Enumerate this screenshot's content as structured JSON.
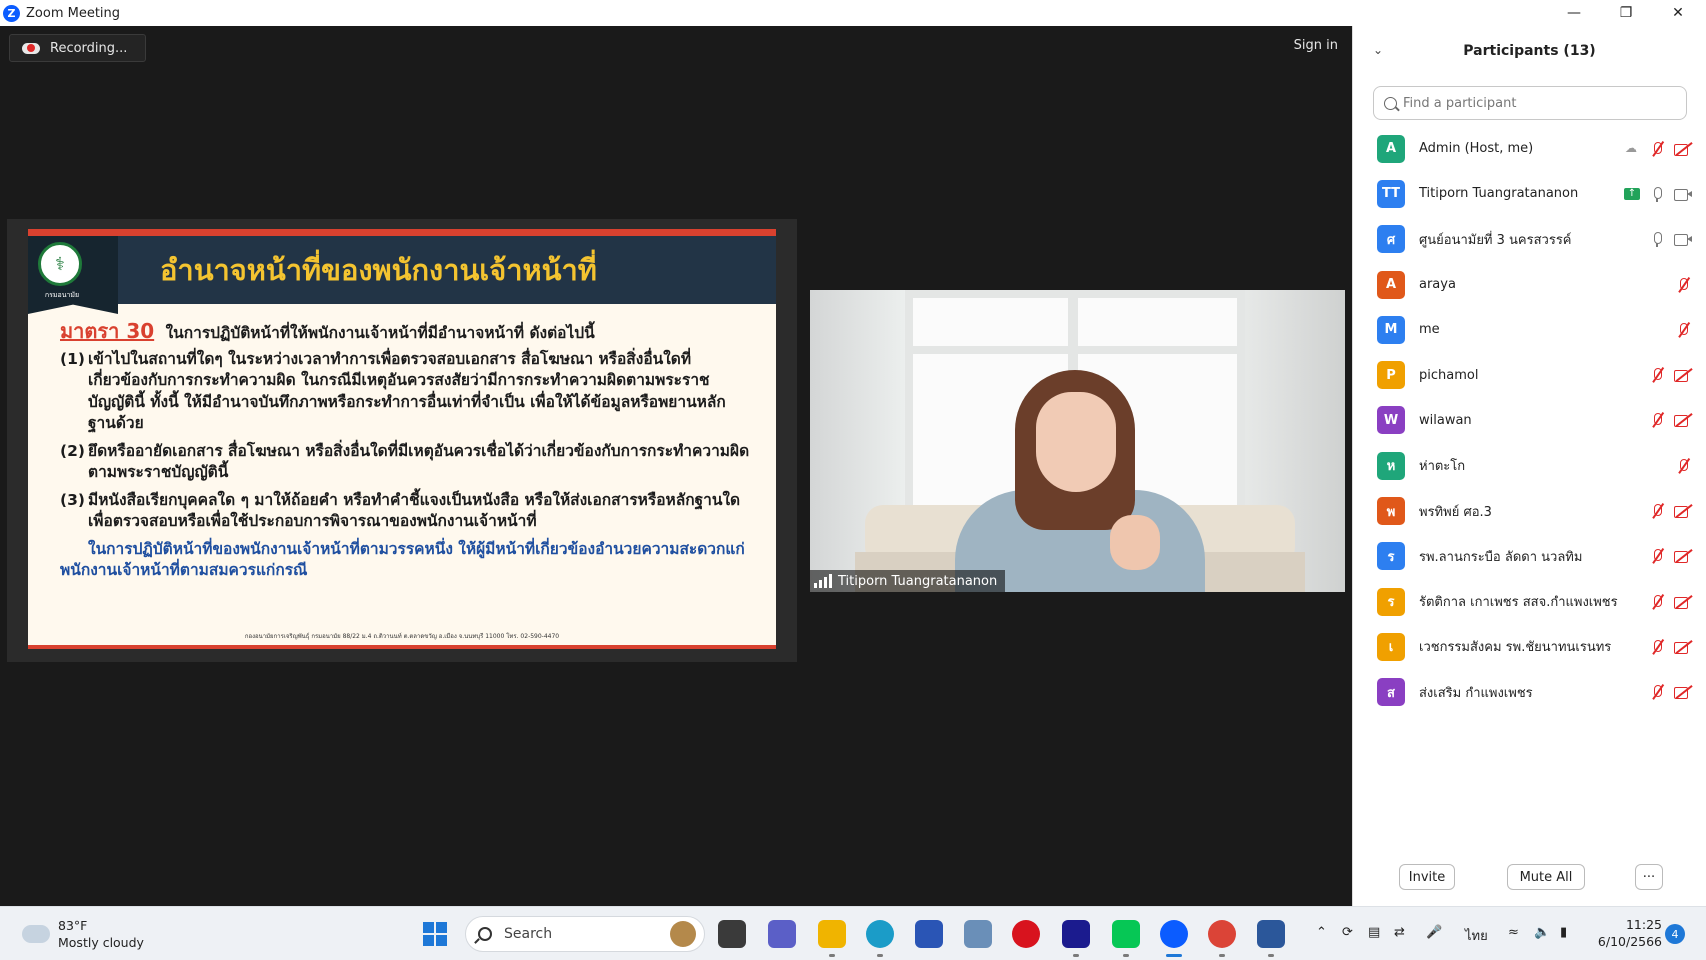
{
  "window": {
    "title": "Zoom Meeting",
    "minimize_icon": "minimize-icon",
    "restore_icon": "restore-icon",
    "close_icon": "close-icon"
  },
  "meeting": {
    "recording_label": "Recording...",
    "signin_label": "Sign in",
    "speaker_name": "Titiporn Tuangratananon"
  },
  "slide": {
    "logo_text": "กรมอนามัย",
    "title": "อำนาจหน้าที่ของพนักงานเจ้าหน้าที่",
    "section_no": "มาตรา 30",
    "section_text": "ในการปฏิบัติหน้าที่ให้พนักงานเจ้าหน้าที่มีอำนาจหน้าที่ ดังต่อไปนี้",
    "items": [
      {
        "num": "(1)",
        "text": "เข้าไปในสถานที่ใดๆ ในระหว่างเวลาทำการเพื่อตรวจสอบเอกสาร สื่อโฆษณา หรือสิ่งอื่นใดที่เกี่ยวข้องกับการกระทำความผิด ในกรณีมีเหตุอันควรสงสัยว่ามีการกระทำความผิดตามพระราชบัญญัตินี้ ทั้งนี้ ให้มีอำนาจบันทึกภาพหรือกระทำการอื่นเท่าที่จำเป็น เพื่อให้ได้ข้อมูลหรือพยานหลักฐานด้วย"
      },
      {
        "num": "(2)",
        "text": "ยึดหรืออายัดเอกสาร สื่อโฆษณา หรือสิ่งอื่นใดที่มีเหตุอันควรเชื่อได้ว่าเกี่ยวข้องกับการกระทำความผิดตามพระราชบัญญัตินี้"
      },
      {
        "num": "(3)",
        "text": "มีหนังสือเรียกบุคคลใด ๆ มาให้ถ้อยคำ หรือทำคำชี้แจงเป็นหนังสือ หรือให้ส่งเอกสารหรือหลักฐานใดเพื่อตรวจสอบหรือเพื่อใช้ประกอบการพิจารณาของพนักงานเจ้าหน้าที่"
      }
    ],
    "note": "ในการปฏิบัติหน้าที่ของพนักงานเจ้าหน้าที่ตามวรรคหนึ่ง ให้ผู้มีหน้าที่เกี่ยวข้องอำนวยความสะดวกแก่พนักงานเจ้าหน้าที่ตามสมควรแก่กรณี",
    "footer": "กองอนามัยการเจริญพันธุ์ กรมอนามัย 88/22 ม.4 ถ.ติวานนท์ ต.ตลาดขวัญ อ.เมือง จ.นนทบุรี 11000 โทร. 02-590-4470"
  },
  "participants": {
    "title": "Participants (13)",
    "search_placeholder": "Find a participant",
    "list": [
      {
        "initial": "A",
        "name": "Admin (Host, me)",
        "color": "#1fa67a",
        "mic": "muted",
        "cam": "off",
        "extra": "recording"
      },
      {
        "initial": "TT",
        "name": "Titiporn Tuangratananon",
        "color": "#2d7ff0",
        "mic": "on",
        "cam": "on",
        "extra": "sharing"
      },
      {
        "initial": "ศ",
        "name": "ศูนย์อนามัยที่ 3 นครสวรรค์",
        "color": "#2d7ff0",
        "mic": "on",
        "cam": "on",
        "extra": ""
      },
      {
        "initial": "A",
        "name": "araya",
        "color": "#e0581a",
        "mic": "muted",
        "cam": "",
        "extra": ""
      },
      {
        "initial": "M",
        "name": "me",
        "color": "#2d7ff0",
        "mic": "muted",
        "cam": "",
        "extra": ""
      },
      {
        "initial": "P",
        "name": "pichamol",
        "color": "#f0a000",
        "mic": "muted",
        "cam": "off",
        "extra": ""
      },
      {
        "initial": "W",
        "name": "wilawan",
        "color": "#8a3fc2",
        "mic": "muted",
        "cam": "off",
        "extra": ""
      },
      {
        "initial": "ห",
        "name": "ห่าตะโก",
        "color": "#1fa67a",
        "mic": "muted",
        "cam": "",
        "extra": ""
      },
      {
        "initial": "พ",
        "name": "พรทิพย์ ศอ.3",
        "color": "#e0581a",
        "mic": "muted",
        "cam": "off",
        "extra": ""
      },
      {
        "initial": "ร",
        "name": "รพ.ลานกระบือ ลัดดา นวลทิม",
        "color": "#2d7ff0",
        "mic": "muted",
        "cam": "off",
        "extra": ""
      },
      {
        "initial": "ร",
        "name": "รัตติกาล เกาเพชร สสจ.กำแพงเพชร",
        "color": "#f0a000",
        "mic": "muted",
        "cam": "off",
        "extra": ""
      },
      {
        "initial": "เ",
        "name": "เวชกรรมสังคม รพ.ชัยนาทนเรนทร",
        "color": "#f0a000",
        "mic": "muted",
        "cam": "off",
        "extra": ""
      },
      {
        "initial": "ส",
        "name": "ส่งเสริม กำแพงเพชร",
        "color": "#8a3fc2",
        "mic": "muted",
        "cam": "off",
        "extra": ""
      }
    ],
    "invite_label": "Invite",
    "mute_all_label": "Mute All",
    "more_label": "···"
  },
  "taskbar": {
    "weather_temp": "83°F",
    "weather_desc": "Mostly cloudy",
    "search_label": "Search",
    "lang": "ไทย",
    "time": "11:25",
    "date": "6/10/2566",
    "notification_count": "4"
  }
}
